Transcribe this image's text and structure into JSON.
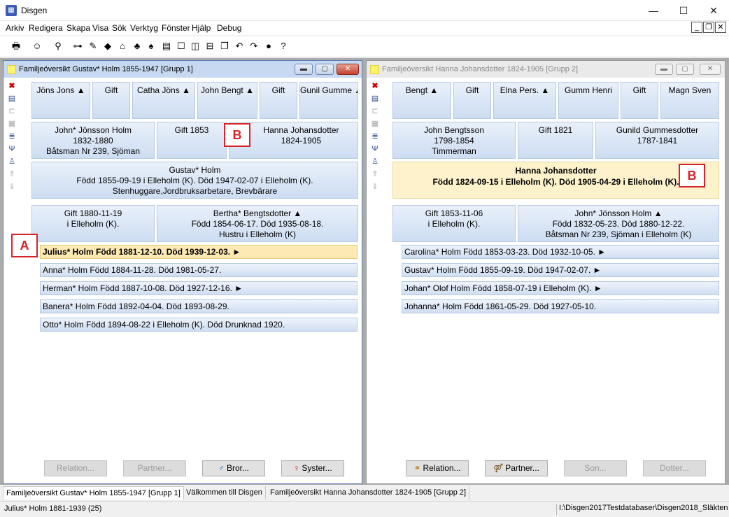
{
  "app": {
    "title": "Disgen",
    "icon": "disgen-app-icon"
  },
  "window_controls": {
    "minimize": "—",
    "maximize": "☐",
    "close": "✕"
  },
  "menu": [
    {
      "label": "Arkiv"
    },
    {
      "label": "Redigera"
    },
    {
      "label": "Skapa"
    },
    {
      "label": "Visa"
    },
    {
      "label": "Sök"
    },
    {
      "label": "Verktyg"
    },
    {
      "label": "Fönster"
    },
    {
      "label": "Hjälp"
    },
    {
      "label": "Debug"
    }
  ],
  "mdi_controls": {
    "minimize": "_",
    "restore": "❐",
    "close": "✕"
  },
  "toolbar": {
    "icons": [
      "print-icon",
      "person-icon",
      "search-person-icon",
      "binoculars-icon",
      "edit-icon",
      "book-icon",
      "home-icon",
      "group-icon",
      "tree-icon",
      "chart-icon",
      "window-single-icon",
      "window-split-vertical-icon",
      "window-split-horizontal-icon",
      "window-cascade-icon",
      "undo-icon",
      "redo-icon",
      "globe-icon",
      "help-icon"
    ]
  },
  "left": {
    "title": "Familjeöversikt Gustav* Holm 1855-1947 [Grupp 1]",
    "grandparents": [
      "Jöns Jons ▲",
      "Gift",
      "Catha Jöns ▲",
      "John Bengt ▲",
      "Gift",
      "Gunil Gumme ▲"
    ],
    "father": {
      "name": "John* Jönsson Holm",
      "years": "1832-1880",
      "note": "Båtsman Nr 239, Sjöman"
    },
    "parents_marriage": "Gift 1853",
    "mother": {
      "name": "Hanna Johansdotter",
      "years": "1824-1905"
    },
    "focus": {
      "name": "Gustav* Holm",
      "line1": "Född 1855-09-19 i Elleholm (K). Död 1947-02-07 i Elleholm (K).",
      "line2": "Stenhuggare,Jordbruksarbetare, Brevbärare"
    },
    "marriage": {
      "line1": "Gift 1880-11-19",
      "line2": "i  Elleholm (K)."
    },
    "spouse": {
      "line1": "Bertha* Bengtsdotter ▲",
      "line2": "Född 1854-06-17. Död 1935-08-18.",
      "line3": "Hustru  i Elleholm (K)"
    },
    "children": [
      "Julius* Holm Född 1881-12-10. Död 1939-12-03. ►",
      "Anna* Holm Född 1884-11-28. Död 1981-05-27.",
      "Herman* Holm Född 1887-10-08. Död 1927-12-16. ►",
      "Banera* Holm Född 1892-04-04. Död 1893-08-29.",
      "Otto* Holm Född 1894-08-22 i Elleholm (K). Död Drunknad  1920."
    ],
    "buttons": [
      "Relation...",
      "Partner...",
      "Bror...",
      "Syster..."
    ]
  },
  "right": {
    "title": "Familjeöversikt Hanna Johansdotter 1824-1905 [Grupp 2]",
    "grandparents": [
      "Bengt ▲",
      "Gift",
      "Elna Pers. ▲",
      "Gumm Henri",
      "Gift",
      "Magn Sven"
    ],
    "father": {
      "name": "John Bengtsson",
      "years": "1798-1854",
      "note": "Timmerman"
    },
    "parents_marriage": "Gift 1821",
    "mother": {
      "name": "Gunild Gummesdotter",
      "years": "1787-1841"
    },
    "focus": {
      "name": "Hanna Johansdotter",
      "line1": "Född 1824-09-15 i Elleholm (K). Död 1905-04-29 i Elleholm (K)."
    },
    "marriage": {
      "line1": "Gift 1853-11-06",
      "line2": "i  Elleholm (K)."
    },
    "spouse": {
      "line1": "John* Jönsson Holm ▲",
      "line2": "Född 1832-05-23. Död 1880-12-22.",
      "line3": "Båtsman Nr 239, Sjöman  i Elleholm (K)"
    },
    "children": [
      "Carolina* Holm Född 1853-03-23. Död 1932-10-05. ►",
      "Gustav* Holm Född 1855-09-19. Död 1947-02-07. ►",
      "Johan* Olof Holm Född 1858-07-19 i Elleholm (K). ►",
      "Johanna* Holm Född 1861-05-29. Död 1927-05-10."
    ],
    "buttons": [
      "Relation...",
      "Partner...",
      "Son...",
      "Dotter..."
    ]
  },
  "markers": {
    "a": "A",
    "b": "B"
  },
  "tabs": [
    "Familjeöversikt Gustav* Holm 1855-1947 [Grupp 1]",
    "Välkommen till Disgen",
    "Familjeöversikt Hanna Johansdotter 1824-1905 [Grupp 2]"
  ],
  "status": {
    "left": "Julius* Holm 1881-1939 (25)",
    "right": "I:\\Disgen2017Testdatabaser\\Disgen2018_Släkten"
  }
}
